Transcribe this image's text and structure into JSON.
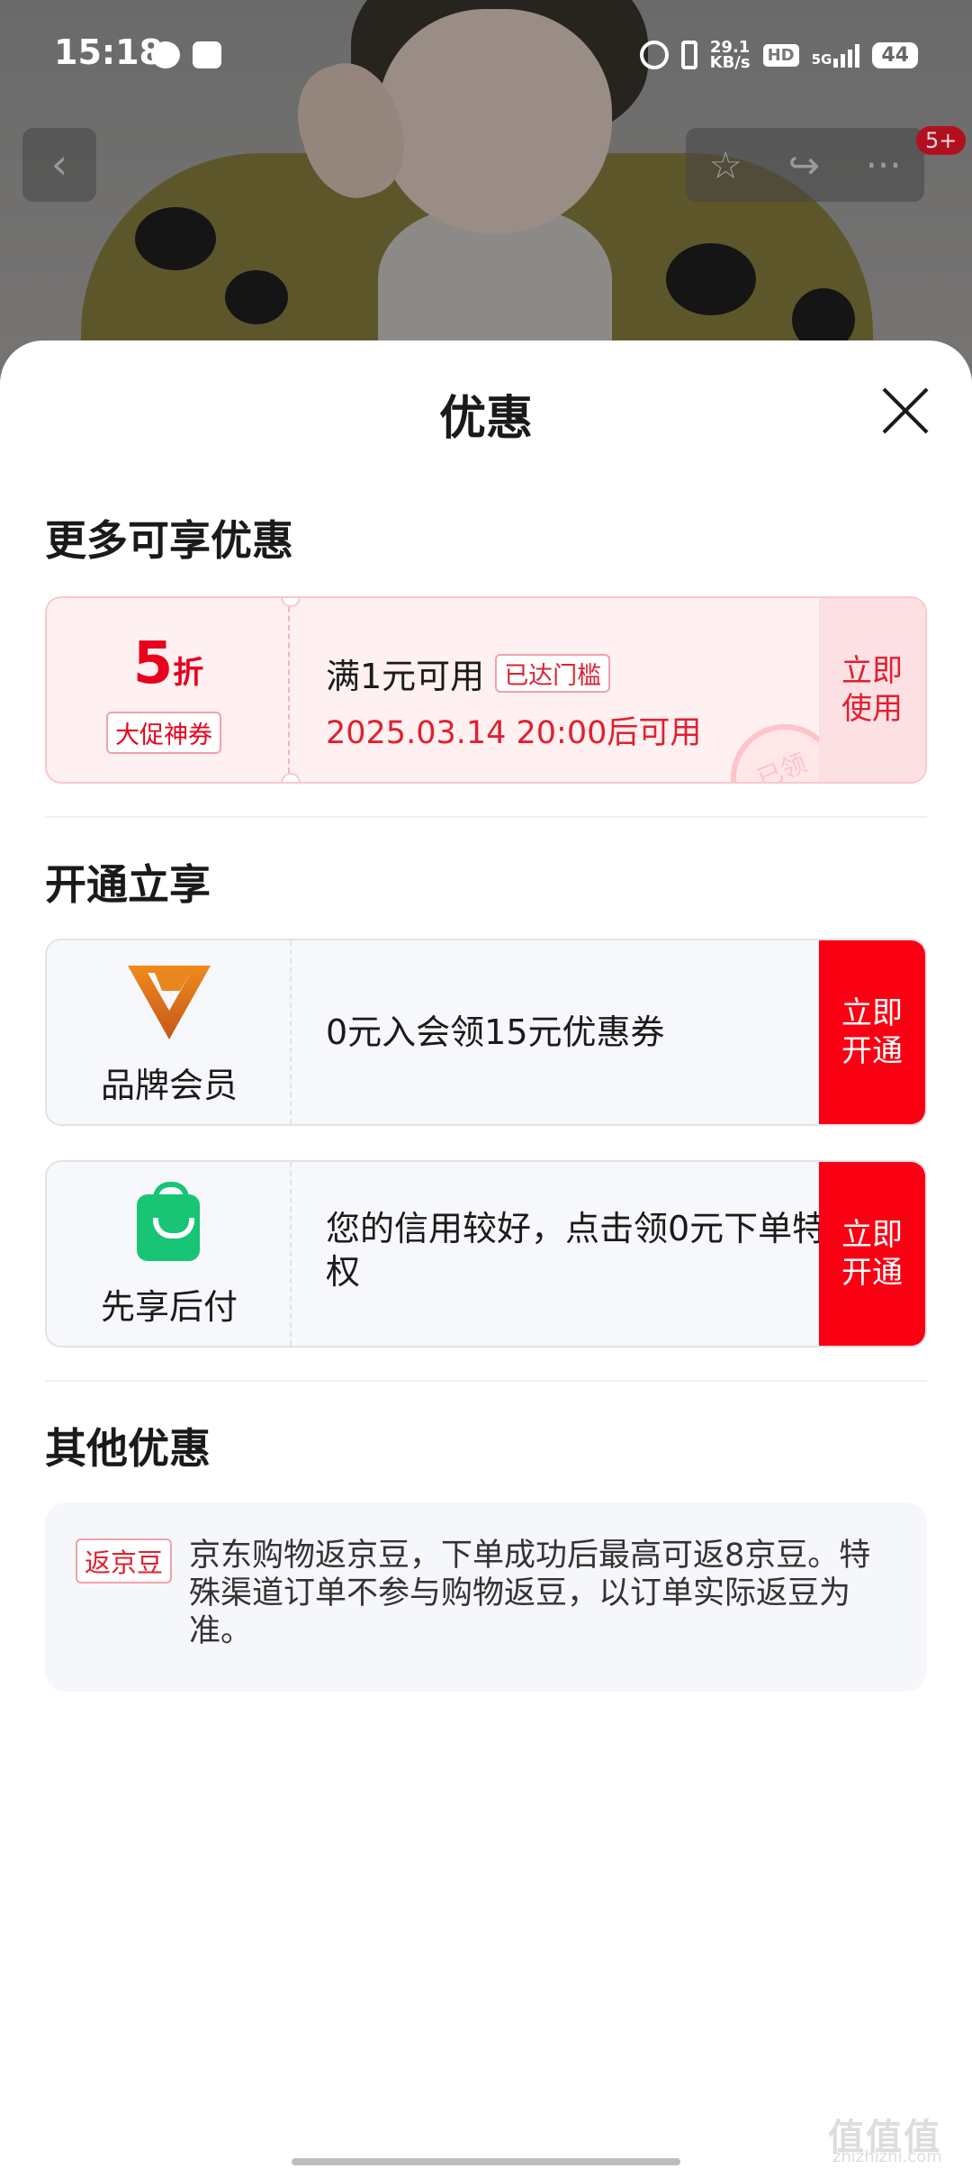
{
  "status_bar": {
    "time": "15:18",
    "net_speed_value": "29.1",
    "net_speed_unit": "KB/s",
    "hd": "HD",
    "network": "5G",
    "battery": "44"
  },
  "top_nav": {
    "back_icon": "‹",
    "favorite_icon": "☆",
    "share_icon": "↪",
    "more_icon": "···",
    "message_badge": "5+"
  },
  "sheet": {
    "title": "优惠",
    "section_more": {
      "title": "更多可享优惠",
      "coupon": {
        "discount_value": "5",
        "discount_unit": "折",
        "coupon_type": "大促神券",
        "condition": "满1元可用",
        "threshold_tag": "已达门槛",
        "valid_time": "2025.03.14 20:00后可用",
        "action": "立即使用",
        "stamp": "已领"
      }
    },
    "section_open": {
      "title": "开通立享",
      "cards": [
        {
          "name": "品牌会员",
          "desc": "0元入会领15元优惠券",
          "action": "立即开通"
        },
        {
          "name": "先享后付",
          "desc": "您的信用较好，点击领0元下单特权",
          "action": "立即开通"
        }
      ]
    },
    "section_other": {
      "title": "其他优惠",
      "beans_tag": "返京豆",
      "beans_text": "京东购物返京豆，下单成功后最高可返8京豆。特殊渠道订单不参与购物返豆，以订单实际返豆为准。"
    }
  },
  "watermark": {
    "main": "值值值",
    "sub": "zhizhizhi.com"
  },
  "colors": {
    "accent_red": "#fa0013",
    "coupon_bg": "#fff0f1",
    "green": "#17c574"
  }
}
